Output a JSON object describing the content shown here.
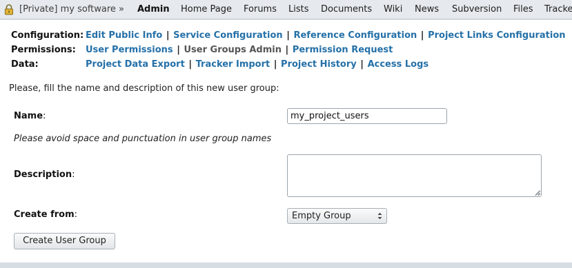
{
  "topnav": {
    "project": "[Private] my software »",
    "tabs": [
      {
        "label": "Admin",
        "active": true
      },
      {
        "label": "Home Page"
      },
      {
        "label": "Forums"
      },
      {
        "label": "Lists"
      },
      {
        "label": "Documents"
      },
      {
        "label": "Wiki"
      },
      {
        "label": "News"
      },
      {
        "label": "Subversion"
      },
      {
        "label": "Files"
      },
      {
        "label": "Tracke"
      }
    ]
  },
  "admin": {
    "configuration": {
      "label": "Configuration:",
      "links": [
        "Edit Public Info",
        "Service Configuration",
        "Reference Configuration",
        "Project Links Configuration"
      ]
    },
    "permissions": {
      "label": "Permissions:",
      "links": [
        "User Permissions",
        "User Groups Admin",
        "Permission Request"
      ],
      "current_index": 1
    },
    "data": {
      "label": "Data:",
      "links": [
        "Project Data Export",
        "Tracker Import",
        "Project History",
        "Access Logs"
      ]
    },
    "separator": "|"
  },
  "form": {
    "intro": "Please, fill the name and description of this new user group:",
    "name_label": "Name",
    "name_value": "my_project_users",
    "name_hint": "Please avoid space and punctuation in user group names",
    "description_label": "Description",
    "description_value": "",
    "create_from_label": "Create from",
    "create_from_value": "Empty Group",
    "colon": ":",
    "submit_label": "Create User Group"
  }
}
